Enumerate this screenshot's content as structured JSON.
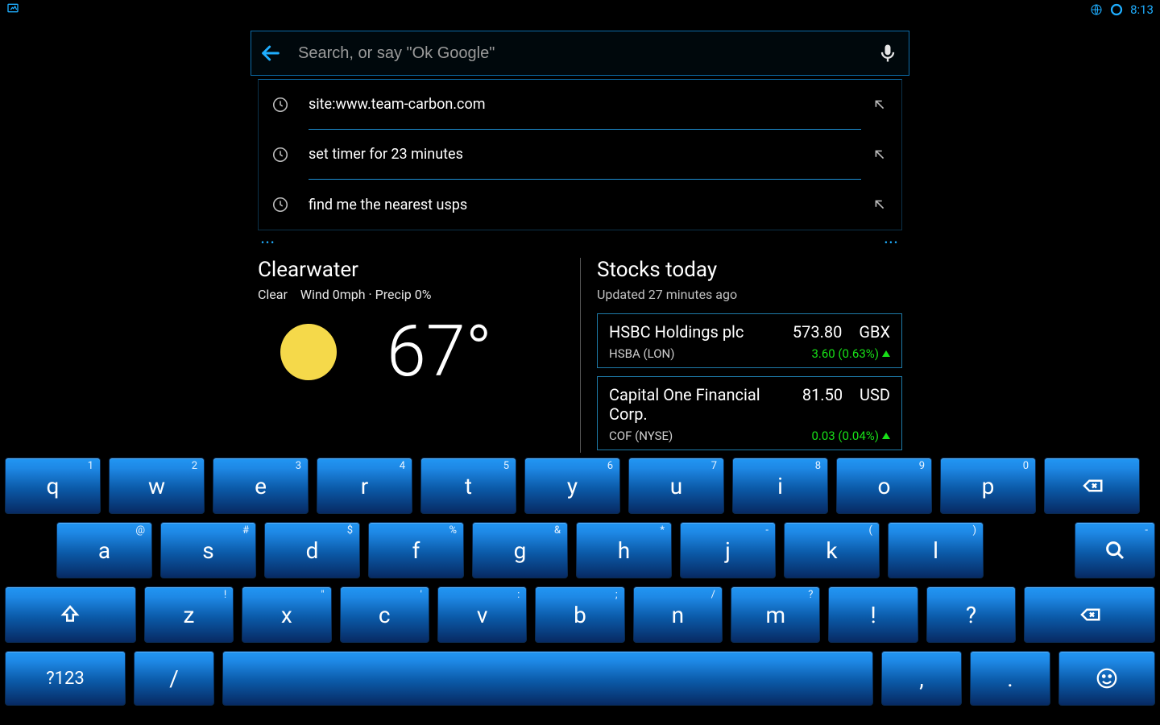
{
  "statusbar": {
    "time": "8:13"
  },
  "search": {
    "placeholder": "Search, or say \"Ok Google\""
  },
  "suggestions": [
    {
      "text": "site:www.team-carbon.com"
    },
    {
      "text": "set timer for 23 minutes"
    },
    {
      "text": "find me the nearest usps"
    }
  ],
  "weather": {
    "location": "Clearwater",
    "condition": "Clear",
    "wind_label": "Wind 0mph",
    "precip_label": "Precip 0%",
    "temp": "67°"
  },
  "stocks": {
    "title": "Stocks today",
    "updated": "Updated 27 minutes ago",
    "items": [
      {
        "name": "HSBC Holdings plc",
        "price": "573.80",
        "currency": "GBX",
        "symbol": "HSBA (LON)",
        "change": "3.60 (0.63%)"
      },
      {
        "name": "Capital One Financial Corp.",
        "price": "81.50",
        "currency": "USD",
        "symbol": "COF (NYSE)",
        "change": "0.03 (0.04%)"
      }
    ]
  },
  "keyboard": {
    "row1": [
      {
        "k": "q",
        "h": "1"
      },
      {
        "k": "w",
        "h": "2"
      },
      {
        "k": "e",
        "h": "3"
      },
      {
        "k": "r",
        "h": "4"
      },
      {
        "k": "t",
        "h": "5"
      },
      {
        "k": "y",
        "h": "6"
      },
      {
        "k": "u",
        "h": "7"
      },
      {
        "k": "i",
        "h": "8"
      },
      {
        "k": "o",
        "h": "9"
      },
      {
        "k": "p",
        "h": "0"
      }
    ],
    "row2": [
      {
        "k": "a",
        "h": "@"
      },
      {
        "k": "s",
        "h": "#"
      },
      {
        "k": "d",
        "h": "$"
      },
      {
        "k": "f",
        "h": "%"
      },
      {
        "k": "g",
        "h": "&"
      },
      {
        "k": "h",
        "h": "*"
      },
      {
        "k": "j",
        "h": "-"
      },
      {
        "k": "k",
        "h": "("
      },
      {
        "k": "l",
        "h": ")"
      }
    ],
    "row3": [
      {
        "k": "z",
        "h": "!"
      },
      {
        "k": "x",
        "h": "\""
      },
      {
        "k": "c",
        "h": "'"
      },
      {
        "k": "v",
        "h": ":"
      },
      {
        "k": "b",
        "h": ";"
      },
      {
        "k": "n",
        "h": "/"
      },
      {
        "k": "m",
        "h": "?"
      }
    ],
    "sym_label": "?123",
    "slash": "/",
    "comma": ",",
    "period": ".",
    "question": "?",
    "exclaim": "!"
  }
}
